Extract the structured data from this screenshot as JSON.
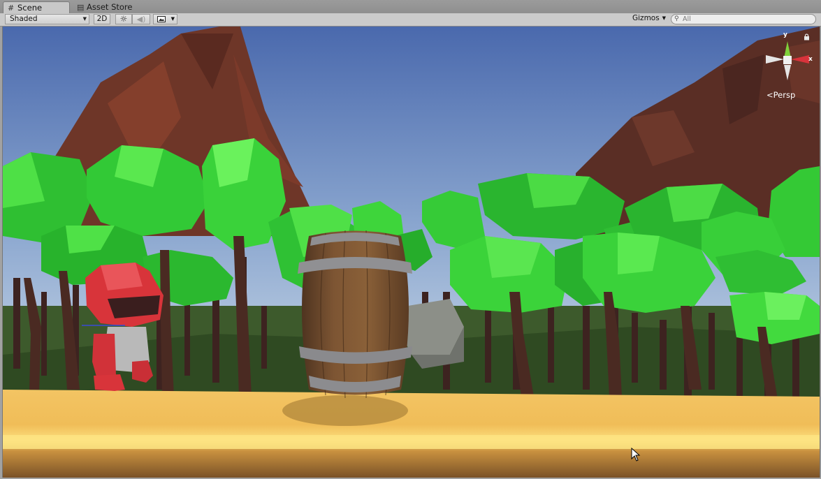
{
  "tabs": [
    {
      "label": "Scene",
      "icon": "scene-grid-icon",
      "active": true
    },
    {
      "label": "Asset Store",
      "icon": "asset-store-icon",
      "active": false
    }
  ],
  "toolbar": {
    "shading_mode": "Shaded",
    "mode_2d_label": "2D",
    "gizmos_label": "Gizmos",
    "search_placeholder": "All",
    "search_value": ""
  },
  "gizmo": {
    "y_label": "y",
    "x_label": "x",
    "projection_label": "Persp"
  },
  "colors": {
    "sky_top": "#4f6fb2",
    "sky_bottom": "#b9cbe0",
    "tree_light": "#3fd93a",
    "tree_dark": "#1e9e27",
    "trunk": "#4a2a22",
    "mountain": "#6b3527",
    "ground": "#f1c25e",
    "barrel_wood": "#7a5232",
    "barrel_band": "#8f8f92",
    "knight_red": "#d8343a",
    "gizmo_y": "#7fd13b",
    "gizmo_x": "#d8333b"
  }
}
